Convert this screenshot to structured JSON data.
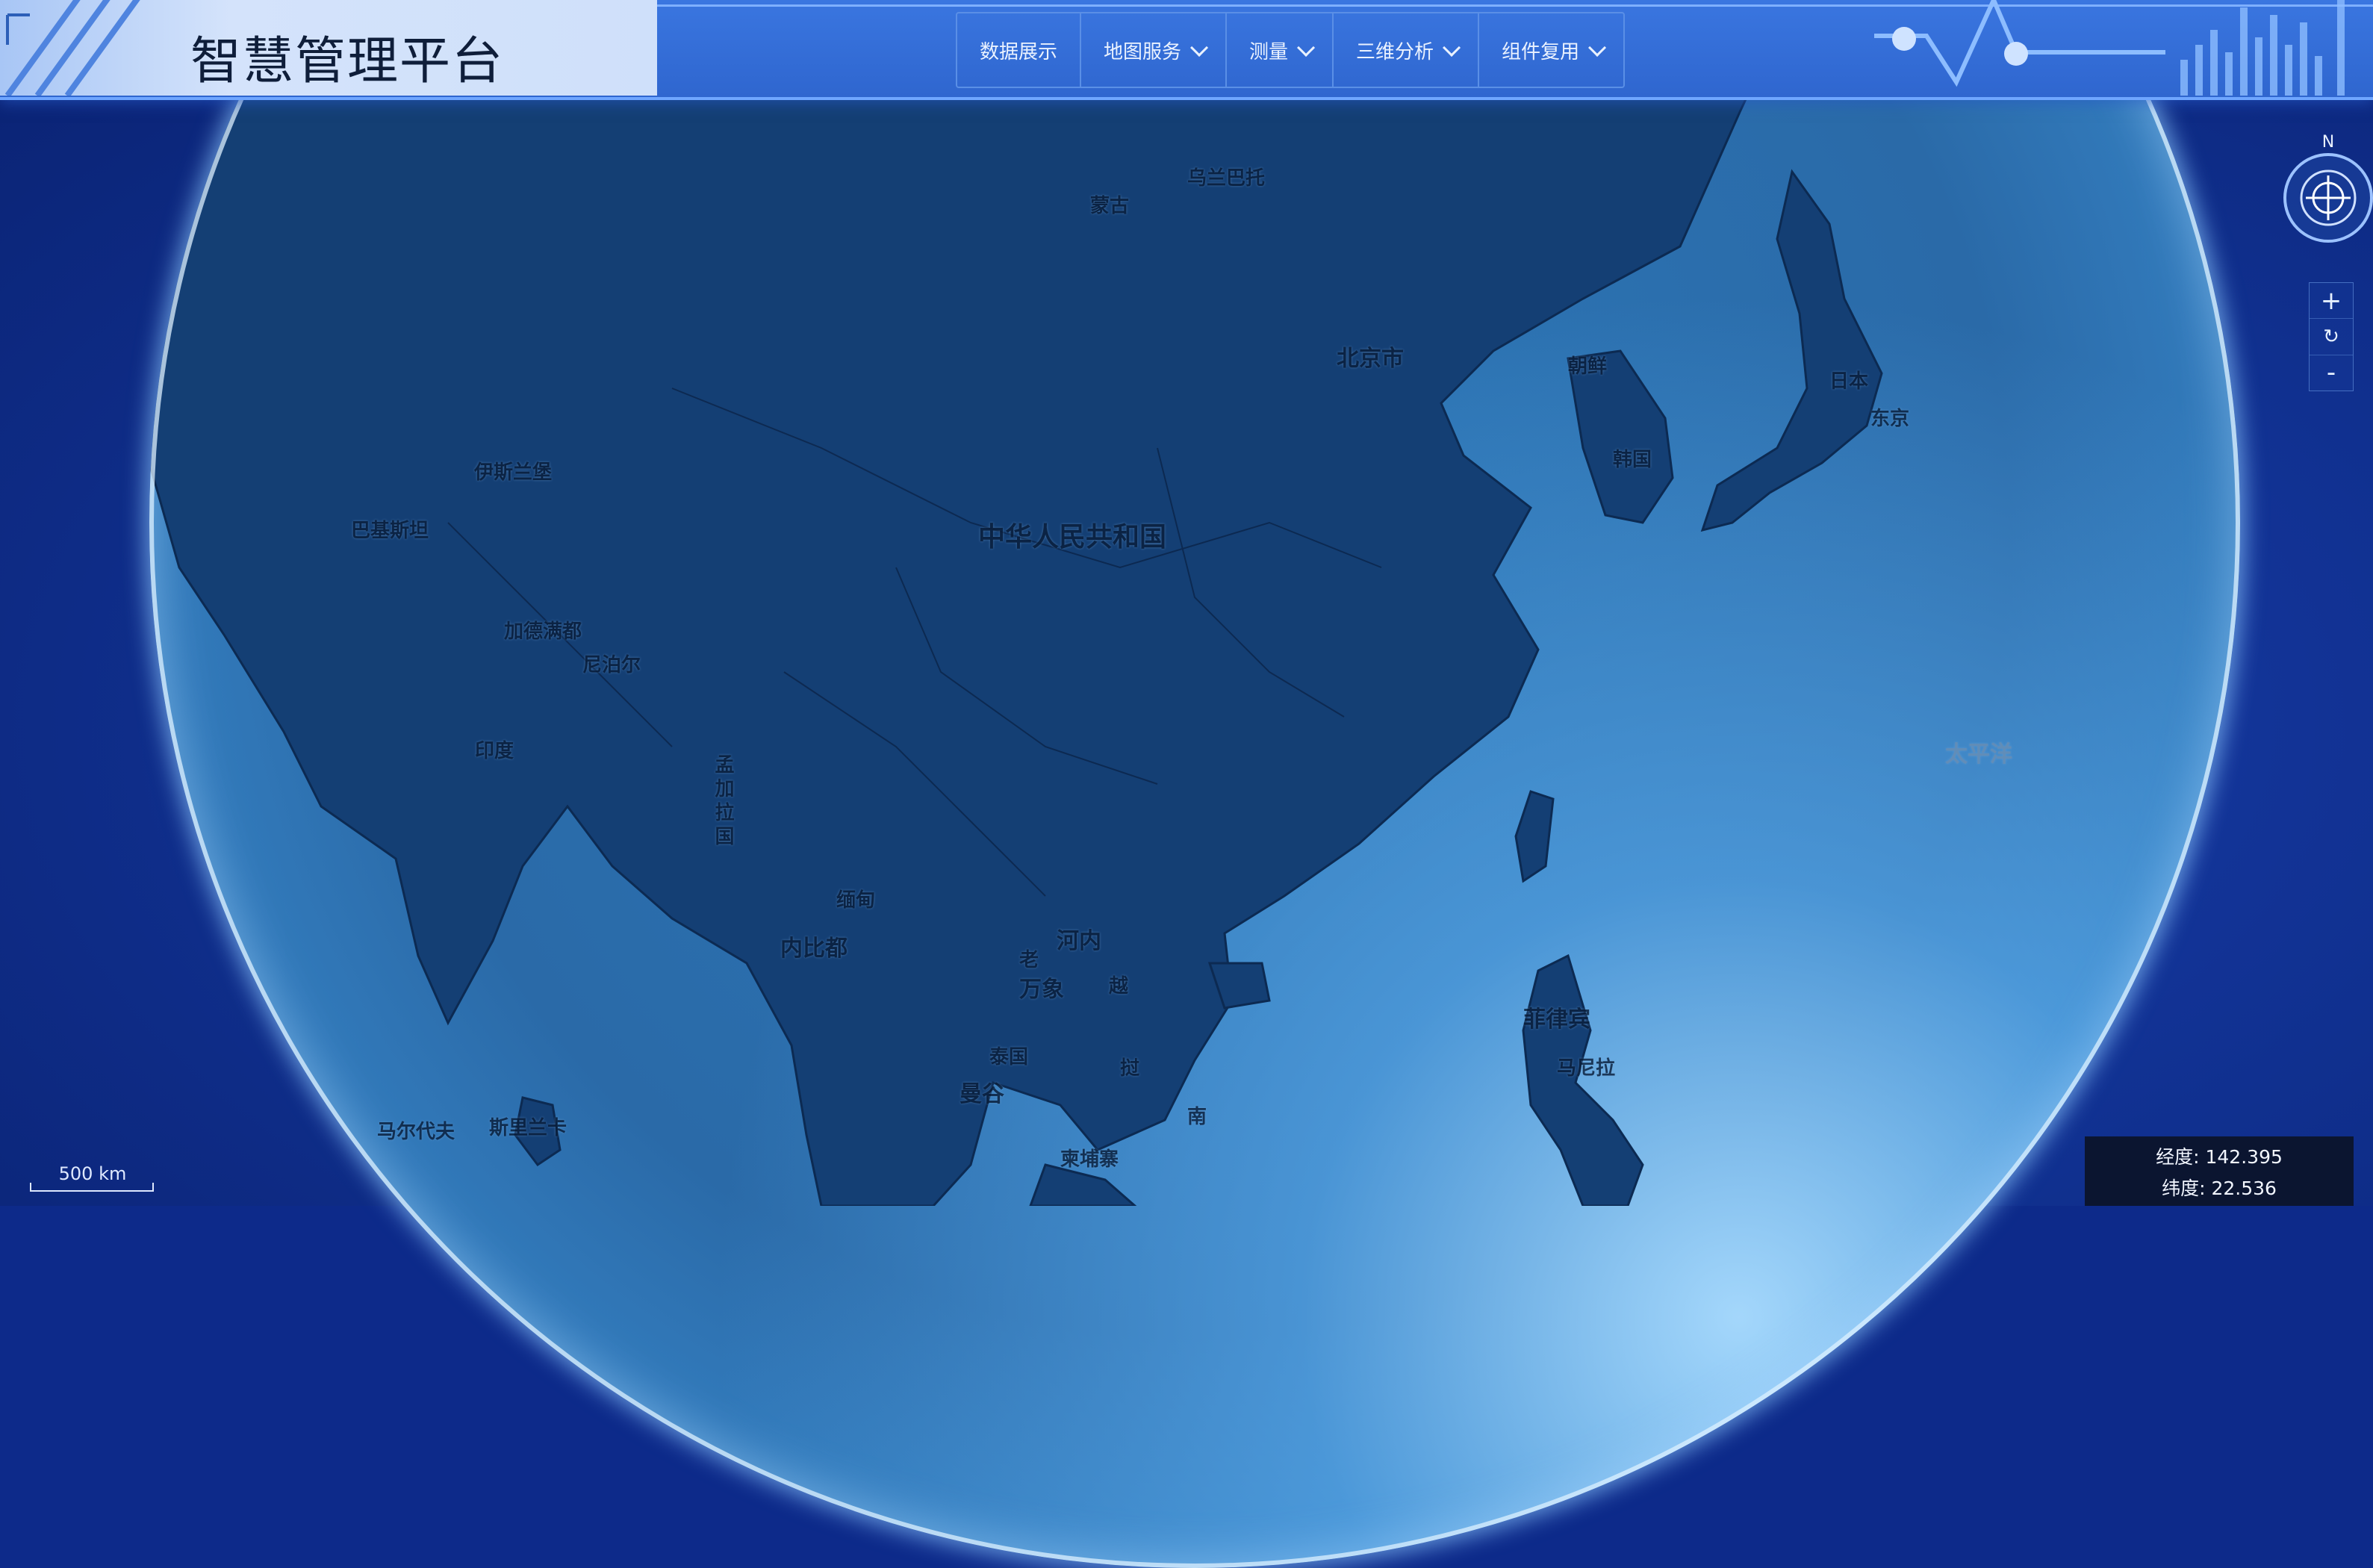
{
  "app": {
    "title": "智慧管理平台"
  },
  "nav": {
    "items": [
      {
        "label": "数据展示",
        "has_dropdown": false
      },
      {
        "label": "地图服务",
        "has_dropdown": true
      },
      {
        "label": "测量",
        "has_dropdown": true
      },
      {
        "label": "三维分析",
        "has_dropdown": true
      },
      {
        "label": "组件复用",
        "has_dropdown": true
      }
    ]
  },
  "map": {
    "labels": {
      "china": "中华人民共和国",
      "beijing": "北京市",
      "mongolia": "蒙古",
      "ulaanbaatar": "乌兰巴托",
      "north_korea": "朝鲜",
      "south_korea": "韩国",
      "japan": "日本",
      "tokyo": "东京",
      "india": "印度",
      "nepal": "尼泊尔",
      "kathmandu": "加德满都",
      "islamabad": "伊斯兰堡",
      "pakistan": "巴基斯坦",
      "bangladesh": "孟加拉国",
      "myanmar": "缅甸",
      "naypyidaw": "内比都",
      "hanoi": "河内",
      "laos": "老",
      "vientiane": "万象",
      "thailand": "泰国",
      "bangkok": "曼谷",
      "cambodia": "柬埔寨",
      "vietnam_yue": "越",
      "vietnam_nan": "南",
      "philippines": "菲律宾",
      "manila": "马尼拉",
      "sri_lanka": "斯里兰卡",
      "maldives": "马尔代夫",
      "pacific": "太平洋"
    }
  },
  "compass": {
    "north_label": "N"
  },
  "zoom": {
    "in_label": "+",
    "reset_label": "↻",
    "out_label": "-"
  },
  "scale": {
    "label": "500 km"
  },
  "coords": {
    "longitude_label": "经度:",
    "longitude_value": "142.395",
    "latitude_label": "纬度:",
    "latitude_value": "22.536"
  },
  "colors": {
    "header": "#2f66cf",
    "title_panel": "#cfe0fa",
    "ocean": "#2a6aa8",
    "land": "#123a6e",
    "space": "#10308f"
  }
}
